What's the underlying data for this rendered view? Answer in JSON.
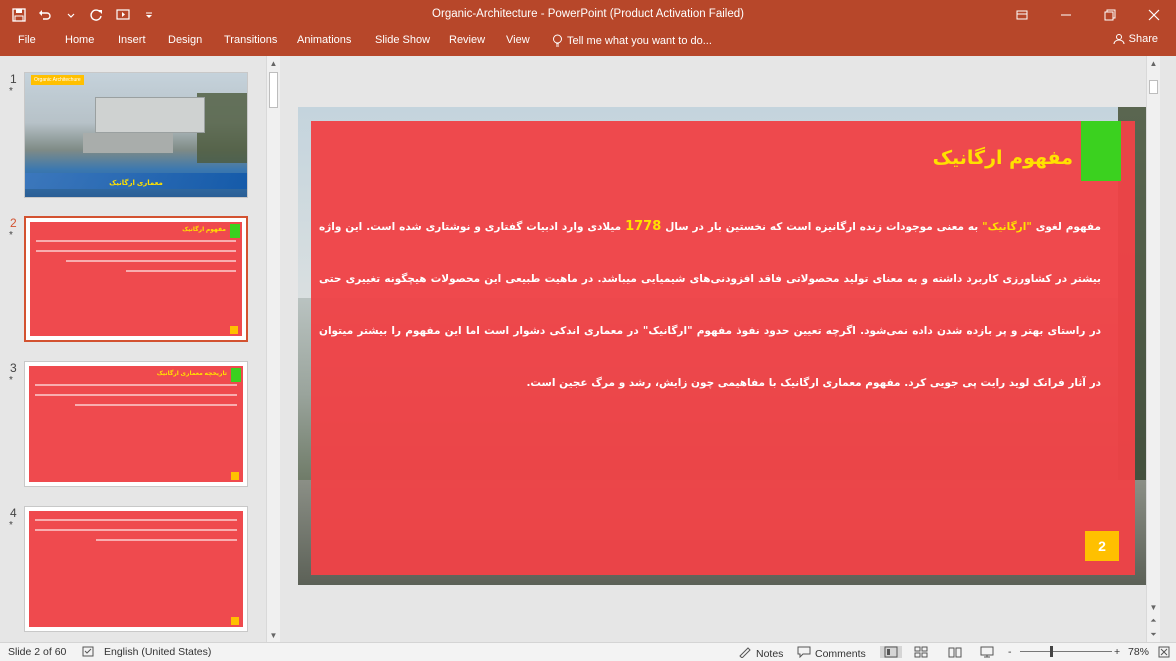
{
  "window": {
    "title": "Organic-Architecture - PowerPoint (Product Activation Failed)"
  },
  "ribbon": {
    "tabs": [
      "File",
      "Home",
      "Insert",
      "Design",
      "Transitions",
      "Animations",
      "Slide Show",
      "Review",
      "View"
    ],
    "tell_me": "Tell me what you want to do...",
    "share": "Share"
  },
  "thumbnails": [
    {
      "number": "1",
      "star": "*",
      "label": "Organic Architechure",
      "title": "معماری ارگانیک"
    },
    {
      "number": "2",
      "star": "*",
      "title": "مفهوم ارگانیک",
      "page": "2"
    },
    {
      "number": "3",
      "star": "*",
      "title": "تاریخچه معماری ارگانیک",
      "page": "3"
    },
    {
      "number": "4",
      "star": "*",
      "page": "4"
    }
  ],
  "slide": {
    "title": "مفهوم ارگانیک",
    "body_part1": "مفهوم لغوی ",
    "body_highlight": "\"ارگانیک\"",
    "body_part2": " به معنی موجودات زنده ارگانیزه است که نخستین بار در سال ",
    "body_year": "1778",
    "body_part3": " میلادی وارد ادبیات گفتاری و نوشتاری شده است. این واژه بیشتر در کشاورزی کاربرد داشته و به معنای تولید محصولاتی فاقد افزودنی‌های شیمیایی میباشد. در ماهیت طبیعی این محصولات هیچگونه تغییری حتی در راستای بهتر و پر بازده شدن داده نمی‌شود. اگرچه تعیین حدود نفوذ مفهوم \"ارگانیک\" در معماری اندکی دشوار است اما این مفهوم را بیشتر میتوان در آثار فرانک لوید رایت پی جویی کرد. مفهوم معماری ارگانیک با مفاهیمی چون زایش، رشد و مرگ عجین است.",
    "page_number": "2"
  },
  "status": {
    "slide_of": "Slide 2 of 60",
    "language": "English (United States)",
    "notes": "Notes",
    "comments": "Comments",
    "zoom_out": "-",
    "zoom_in": "+",
    "zoom": "78%"
  },
  "colors": {
    "accent": "#b7472a",
    "slide_red": "#ef4347",
    "title_yellow": "#ffe100",
    "green_block": "#3bd11f",
    "page_badge": "#ffc000"
  }
}
